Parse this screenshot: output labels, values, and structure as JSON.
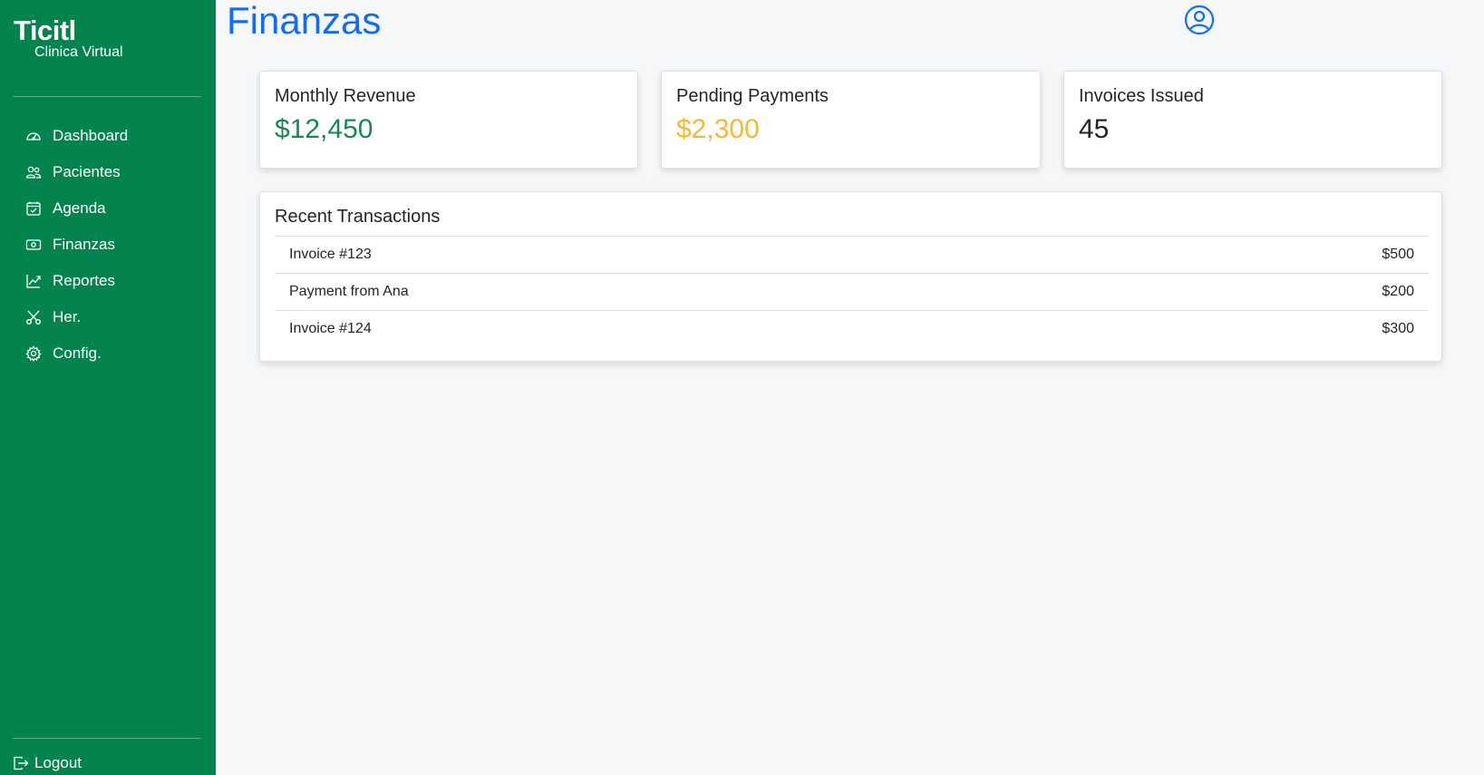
{
  "brand": {
    "name": "Ticitl",
    "subtitle": "Clinica Virtual"
  },
  "sidebar": {
    "items": [
      {
        "label": "Dashboard",
        "icon": "speedometer-icon"
      },
      {
        "label": "Pacientes",
        "icon": "people-icon"
      },
      {
        "label": "Agenda",
        "icon": "calendar-check-icon"
      },
      {
        "label": "Finanzas",
        "icon": "cash-icon"
      },
      {
        "label": "Reportes",
        "icon": "graph-up-icon"
      },
      {
        "label": "Her.",
        "icon": "scissors-icon"
      },
      {
        "label": "Config.",
        "icon": "gear-icon"
      }
    ],
    "logout": {
      "label": "Logout",
      "icon": "logout-icon"
    }
  },
  "header": {
    "title": "Finanzas",
    "user_icon": "user-circle-icon"
  },
  "stats": [
    {
      "title": "Monthly Revenue",
      "value": "$12,450",
      "color": "#198754"
    },
    {
      "title": "Pending Payments",
      "value": "$2,300",
      "color": "#f7b731"
    },
    {
      "title": "Invoices Issued",
      "value": "45",
      "color": "#212529"
    }
  ],
  "transactions": {
    "title": "Recent Transactions",
    "rows": [
      {
        "label": "Invoice #123",
        "amount": "$500"
      },
      {
        "label": "Payment from Ana",
        "amount": "$200"
      },
      {
        "label": "Invoice #124",
        "amount": "$300"
      }
    ]
  },
  "colors": {
    "sidebar": "#04844d",
    "accent": "#0d6efd",
    "background": "#f6f7f9"
  }
}
